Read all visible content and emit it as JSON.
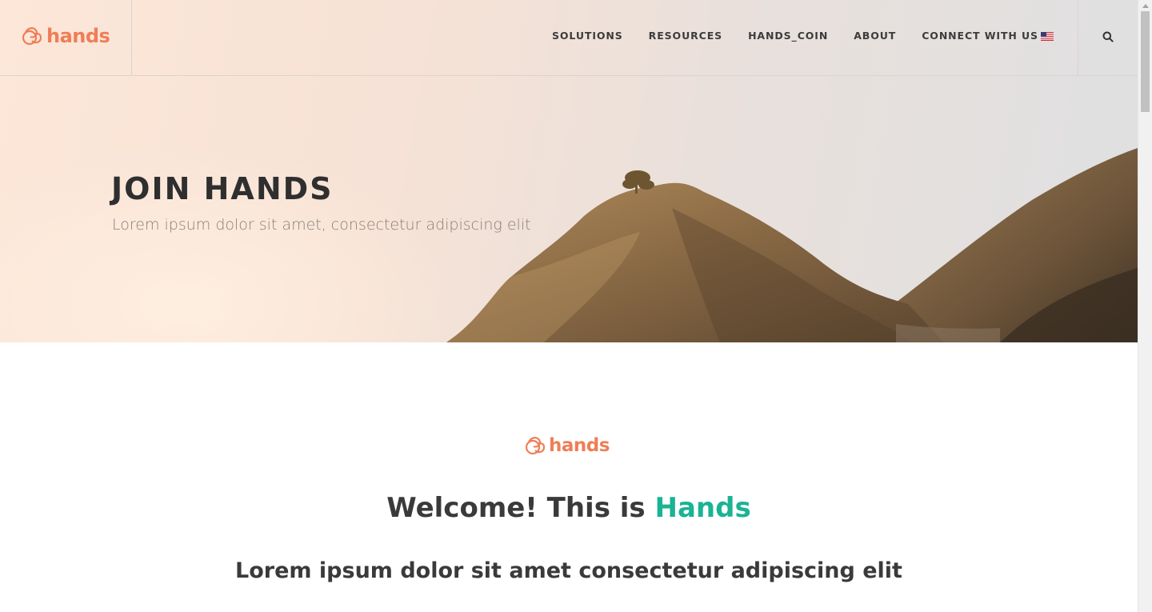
{
  "brand": {
    "name": "hands",
    "color": "#ef7e56"
  },
  "nav": {
    "items": [
      "SOLUTIONS",
      "RESOURCES",
      "HANDS_COIN",
      "ABOUT",
      "CONNECT WITH US"
    ],
    "language_icon": "us-flag-icon",
    "search_icon": "search-icon"
  },
  "hero": {
    "title": "JOIN HANDS",
    "subtitle": "Lorem ipsum dolor sit amet, consectetur adipiscing elit"
  },
  "welcome": {
    "logo_text": "hands",
    "title_prefix": "Welcome! This is ",
    "title_accent": "Hands",
    "accent_color": "#1ab394",
    "subtitle": "Lorem ipsum dolor sit amet consectetur adipiscing elit"
  }
}
